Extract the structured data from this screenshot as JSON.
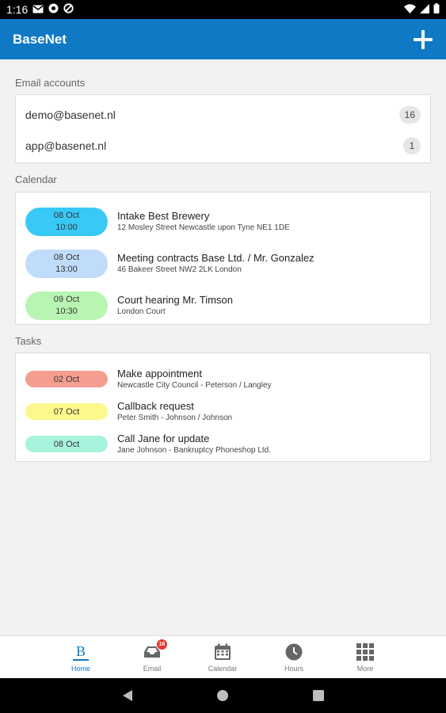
{
  "status_bar": {
    "time": "1:16",
    "icons": [
      "gmail-icon",
      "camera-icon",
      "blocked-icon",
      "wifi-icon",
      "signal-icon",
      "battery-icon"
    ]
  },
  "app_bar": {
    "title": "BaseNet",
    "action_icon": "plus-icon",
    "background_color": "#0f79c6"
  },
  "email_section": {
    "title": "Email accounts",
    "accounts": [
      {
        "address": "demo@basenet.nl",
        "count": "16"
      },
      {
        "address": "app@basenet.nl",
        "count": "1"
      }
    ]
  },
  "calendar_section": {
    "title": "Calendar",
    "events": [
      {
        "date": "08 Oct",
        "time": "10:00",
        "title": "Intake Best Brewery",
        "location": "12 Mosley Street Newcastle upon Tyne NE1 1DE",
        "color": "#39c9f7"
      },
      {
        "date": "08 Oct",
        "time": "13:00",
        "title": "Meeting contracts Base Ltd. / Mr. Gonzalez",
        "location": "46 Bakeer Street NW2 2LK London",
        "color": "#bfdcfa"
      },
      {
        "date": "09 Oct",
        "time": "10:30",
        "title": "Court hearing Mr. Timson",
        "location": "London Court",
        "color": "#b9f5b2"
      }
    ]
  },
  "tasks_section": {
    "title": "Tasks",
    "tasks": [
      {
        "date": "02 Oct",
        "title": "Make appointment",
        "detail": "Newcastle City Council - Peterson / Langley",
        "color": "#f59e8f"
      },
      {
        "date": "07 Oct",
        "title": "Callback request",
        "detail": "Peter Smith - Johnson / Johnson",
        "color": "#fbf98c"
      },
      {
        "date": "08 Oct",
        "title": "Call Jane for update",
        "detail": "Jane Johnson - Bankruptcy Phoneshop Ltd.",
        "color": "#a8f3dd"
      }
    ]
  },
  "bottom_nav": {
    "items": [
      {
        "label": "Home",
        "icon": "home-icon",
        "active": true
      },
      {
        "label": "Email",
        "icon": "inbox-icon",
        "badge": "16"
      },
      {
        "label": "Calendar",
        "icon": "calendar-icon"
      },
      {
        "label": "Hours",
        "icon": "clock-icon"
      },
      {
        "label": "More",
        "icon": "grid-icon"
      }
    ]
  },
  "system_nav": {
    "buttons": [
      "back-icon",
      "home-circle-icon",
      "recents-icon"
    ]
  }
}
